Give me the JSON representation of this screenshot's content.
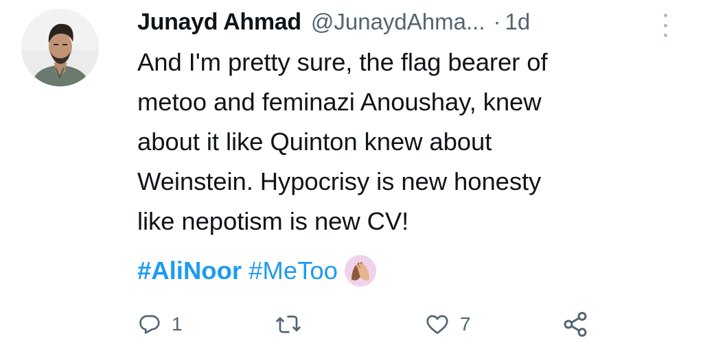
{
  "tweet": {
    "author_name": "Junayd Ahmad",
    "author_handle": "@JunaydAhma...",
    "separator": "·",
    "time": "1d",
    "text": "And I'm pretty sure, the flag bearer of\nmetoo and feminazi Anoushay, knew\nabout it like Quinton knew about\nWeinstein. Hypocrisy is new honesty\nlike nepotism is new CV!",
    "hashtags": [
      "#AliNoor",
      "#MeToo"
    ],
    "emoji": "raised-hands-emoji"
  },
  "actions": {
    "reply_count": "1",
    "retweet_count": "",
    "like_count": "7"
  },
  "icons": {
    "reply": "reply-icon",
    "retweet": "retweet-icon",
    "like": "heart-icon",
    "share": "share-icon",
    "more": "more-options-icon"
  },
  "colors": {
    "text": "#0f1419",
    "secondary": "#536471",
    "link": "#1d9bf0"
  }
}
